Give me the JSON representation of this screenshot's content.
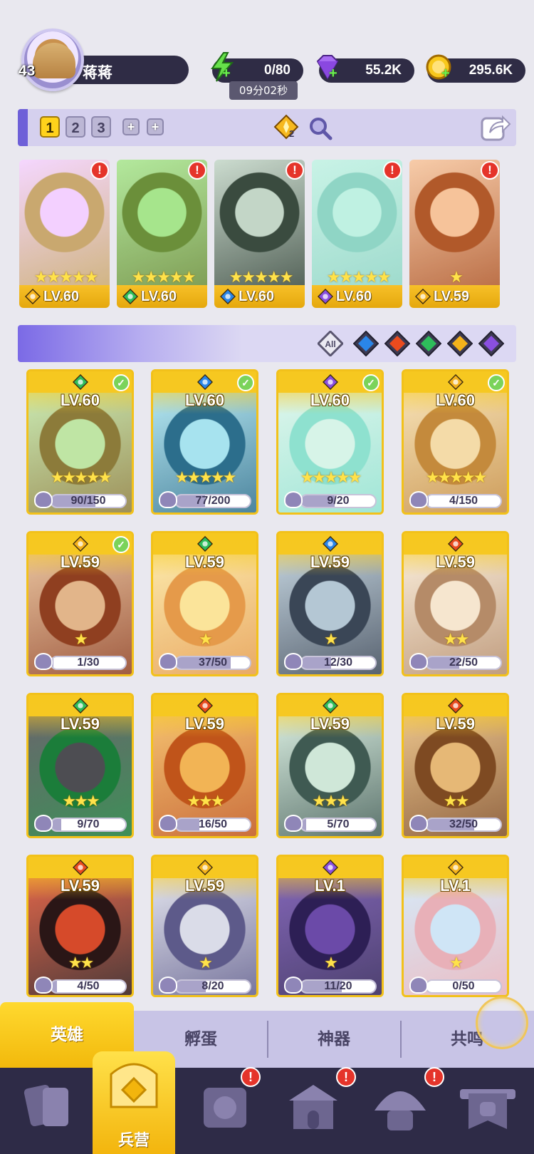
{
  "player": {
    "level": "43",
    "name": "蒋蒋"
  },
  "resources": {
    "energy": {
      "value": "0/80",
      "timer": "09分02秒",
      "icon": "lightning-icon"
    },
    "gems": {
      "value": "55.2K",
      "icon": "gem-icon"
    },
    "gold": {
      "value": "295.6K",
      "icon": "coin-icon"
    }
  },
  "team_bar": {
    "tabs": [
      "1",
      "2",
      "3"
    ],
    "active_tab": "1",
    "add_labels": [
      "+",
      "+"
    ],
    "boost_count": "2",
    "icons": [
      "diamond-boost-icon",
      "magnifier-icon",
      "share-icon"
    ]
  },
  "team": [
    {
      "level": "LV.60",
      "element": "light",
      "stars": "★★★★★",
      "alert": "!"
    },
    {
      "level": "LV.60",
      "element": "nature",
      "stars": "★★★★★",
      "alert": "!"
    },
    {
      "level": "LV.60",
      "element": "water",
      "stars": "★★★★★",
      "alert": "!"
    },
    {
      "level": "LV.60",
      "element": "dark",
      "stars": "★★★★★",
      "alert": "!"
    },
    {
      "level": "LV.59",
      "element": "light",
      "stars": "★",
      "alert": "!"
    }
  ],
  "filters": {
    "all_label": "All",
    "elements": [
      "water",
      "fire",
      "nature",
      "light",
      "dark"
    ]
  },
  "heroes": [
    {
      "level": "LV.60",
      "element": "nature",
      "checked": true,
      "stars": "★★★★★",
      "progress": "90/150",
      "ratio": 0.6
    },
    {
      "level": "LV.60",
      "element": "water",
      "checked": true,
      "stars": "★★★★★",
      "progress": "77/200",
      "ratio": 0.385
    },
    {
      "level": "LV.60",
      "element": "dark",
      "checked": true,
      "stars": "★★★★★",
      "progress": "9/20",
      "ratio": 0.45
    },
    {
      "level": "LV.60",
      "element": "light",
      "checked": true,
      "stars": "★★★★★",
      "progress": "4/150",
      "ratio": 0.027
    },
    {
      "level": "LV.59",
      "element": "light",
      "checked": true,
      "stars": "★",
      "progress": "1/30",
      "ratio": 0.033
    },
    {
      "level": "LV.59",
      "element": "nature",
      "checked": false,
      "stars": "★",
      "progress": "37/50",
      "ratio": 0.74
    },
    {
      "level": "LV.59",
      "element": "water",
      "checked": false,
      "stars": "★",
      "progress": "12/30",
      "ratio": 0.4
    },
    {
      "level": "LV.59",
      "element": "fire",
      "checked": false,
      "stars": "★★",
      "progress": "22/50",
      "ratio": 0.44
    },
    {
      "level": "LV.59",
      "element": "nature",
      "checked": false,
      "stars": "★★★",
      "progress": "9/70",
      "ratio": 0.129
    },
    {
      "level": "LV.59",
      "element": "fire",
      "checked": false,
      "stars": "★★★",
      "progress": "16/50",
      "ratio": 0.32
    },
    {
      "level": "LV.59",
      "element": "nature",
      "checked": false,
      "stars": "★★★",
      "progress": "5/70",
      "ratio": 0.071
    },
    {
      "level": "LV.59",
      "element": "fire",
      "checked": false,
      "stars": "★★",
      "progress": "32/50",
      "ratio": 0.64
    },
    {
      "level": "LV.59",
      "element": "fire",
      "checked": false,
      "stars": "★★",
      "progress": "4/50",
      "ratio": 0.08
    },
    {
      "level": "LV.59",
      "element": "light",
      "checked": false,
      "stars": "★",
      "progress": "8/20",
      "ratio": 0.4
    },
    {
      "level": "LV.1",
      "element": "dark",
      "checked": false,
      "stars": "★",
      "progress": "11/20",
      "ratio": 0.55
    },
    {
      "level": "LV.1",
      "element": "light",
      "checked": false,
      "stars": "★",
      "progress": "0/50",
      "ratio": 0
    }
  ],
  "sub_tabs": {
    "items": [
      "英雄",
      "孵蛋",
      "神器",
      "共鸣"
    ],
    "active": "英雄"
  },
  "bottom_nav": {
    "active_label": "兵营",
    "items": [
      "cards-icon",
      "barracks-icon",
      "map-scroll-icon",
      "temple-icon",
      "mushroom-house-icon",
      "guild-banner-icon"
    ],
    "alerts": [
      "!",
      "!",
      "!"
    ]
  },
  "colors": {
    "light": "#f4b21b",
    "nature": "#2ebd5b",
    "water": "#2a86e8",
    "fire": "#ea4b1e",
    "dark": "#8a4fe0",
    "card_gold": "#f6c923",
    "nav_bg": "#2e2b47",
    "panel": "#d5d0ee"
  }
}
